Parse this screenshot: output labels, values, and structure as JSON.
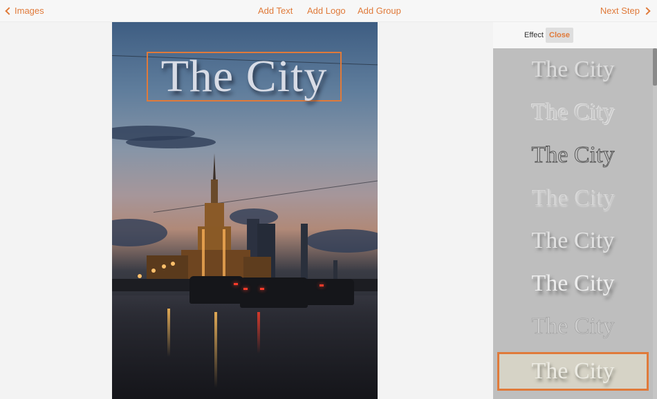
{
  "topbar": {
    "back_label": "Images",
    "actions": [
      "Add Text",
      "Add Logo",
      "Add Group"
    ],
    "next_label": "Next Step"
  },
  "canvas": {
    "overlay_text": "The City"
  },
  "panel": {
    "effect_label": "Effect",
    "close_label": "Close",
    "effects": [
      "The City",
      "The City",
      "The City",
      "The City",
      "The City",
      "The City",
      "The City",
      "The City"
    ],
    "selected_index": 7
  },
  "colors": {
    "accent": "#e07a3a",
    "panel_bg": "#bebebe"
  }
}
